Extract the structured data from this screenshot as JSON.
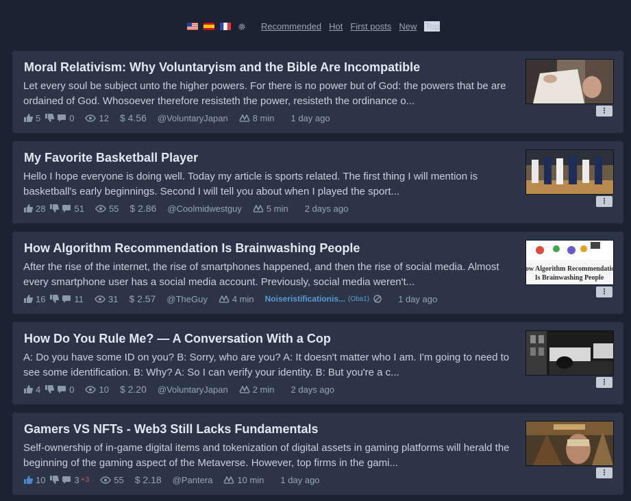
{
  "language_icons": [
    "flag-us-icon",
    "flag-es-icon",
    "flag-fr-icon",
    "gear-icon"
  ],
  "sort_tabs": [
    {
      "label": "Recommended",
      "active": false
    },
    {
      "label": "Hot",
      "active": false
    },
    {
      "label": "First posts",
      "active": false
    },
    {
      "label": "New",
      "active": false
    },
    {
      "label": "Top",
      "active": true
    }
  ],
  "colors": {
    "background": "#1b2230",
    "card": "#2b3547",
    "accent": "#5b9bd5",
    "upvoted": "#4f86c6",
    "alert": "#d0515d"
  },
  "posts": [
    {
      "title": "Moral Relativism: Why Voluntaryism and the Bible Are Incompatible",
      "excerpt": "Let every soul be subject unto the higher powers. For there is no power but of God: the powers that be are ordained of God. Whosoever therefore resisteth the power, resisteth the ordinance o...",
      "upvotes": "5",
      "comments": "0",
      "views": "12",
      "payout": "$ 4.56",
      "author": "@VoluntaryJapan",
      "read_time": "8 min",
      "age": "1 day ago",
      "upvoted": false
    },
    {
      "title": "My Favorite Basketball Player",
      "excerpt": "Hello I hope everyone is doing well. Today my article is sports related. The first thing I will mention is basketball's early beginnings. Second I will tell you about when I played the sport...",
      "upvotes": "28",
      "comments": "51",
      "views": "55",
      "payout": "$ 2.86",
      "author": "@Coolmidwestguy",
      "read_time": "5 min",
      "age": "2 days ago",
      "upvoted": false
    },
    {
      "title": "How Algorithm Recommendation Is Brainwashing People",
      "excerpt": "After the rise of the internet, the rise of smartphones happened, and then the rise of social media. Almost every smartphone user has a social media account. Previously, social media weren't...",
      "upvotes": "16",
      "comments": "11",
      "views": "31",
      "payout": "$ 2.57",
      "author": "@TheGuy",
      "read_time": "4 min",
      "community": "Noiseristificationis...",
      "community_tag": "(Oba1)",
      "age": "1 day ago",
      "upvoted": false,
      "thumb_text": [
        "How Algorithm Recommendation",
        "Is Brainwashing People"
      ]
    },
    {
      "title": "How Do You Rule Me? — A Conversation With a Cop",
      "excerpt": "A: Do you have some ID on you? B: Sorry, who are you? A: It doesn't matter who I am. I'm going to need to see some identification. B: Why? A: So I can verify your identity. B: But you're a c...",
      "upvotes": "4",
      "comments": "0",
      "views": "10",
      "payout": "$ 2.20",
      "author": "@VoluntaryJapan",
      "read_time": "2 min",
      "age": "2 days ago",
      "upvoted": false
    },
    {
      "title": "Gamers VS NFTs - Web3 Still Lacks Fundamentals",
      "excerpt": "Self-ownership of in-game digital items and tokenization of digital assets in gaming platforms will herald the beginning of the gaming aspect of the Metaverse. However, top firms in the gami...",
      "upvotes": "10",
      "comments": "3",
      "new_comments": "+3",
      "views": "55",
      "payout": "$ 2.18",
      "author": "@Pantera",
      "read_time": "10 min",
      "age": "1 day ago",
      "upvoted": true
    }
  ]
}
